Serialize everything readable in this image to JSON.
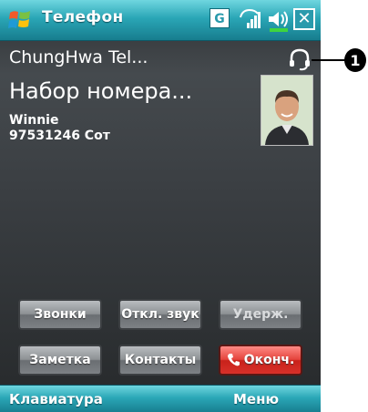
{
  "window": {
    "title": "Телефон"
  },
  "status_icons": {
    "network": "G",
    "close": "✕",
    "icons": [
      "windows-start-icon",
      "g-network-icon",
      "signal-icon",
      "volume-icon",
      "close-icon"
    ]
  },
  "call": {
    "operator": "ChungHwa Tel...",
    "status": "Набор номера...",
    "contact_name": "Winnie",
    "contact_number": "97531246 Сот"
  },
  "buttons": {
    "calls": "Звонки",
    "mute": "Откл. звук",
    "hold": "Удерж.",
    "note": "Заметка",
    "contacts": "Контакты",
    "end": "Оконч."
  },
  "softkeys": {
    "left": "Клавиатура",
    "right": "Меню"
  },
  "callout": {
    "label": "1"
  },
  "colors": {
    "titlebar": "#2aa6b6",
    "end_button": "#e4443d",
    "background": "#3b3f43"
  }
}
